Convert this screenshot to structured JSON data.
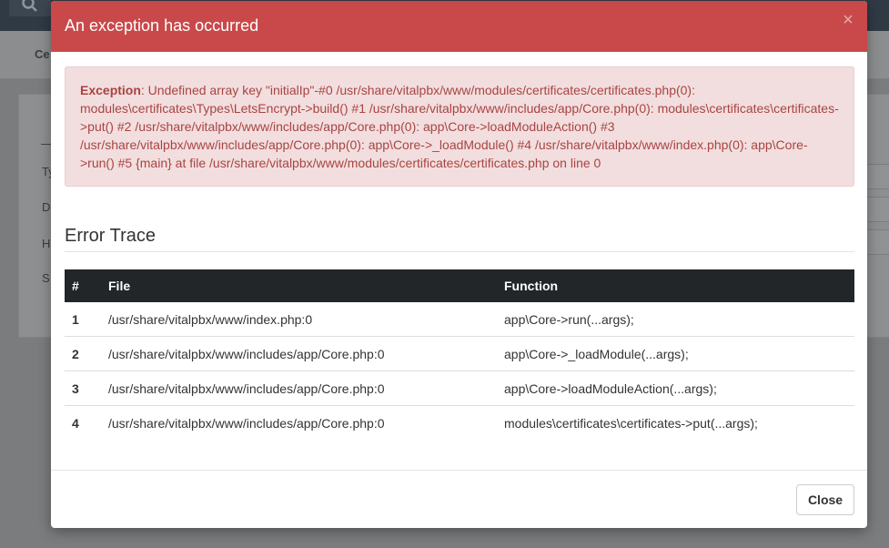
{
  "background": {
    "subbar_label": "Ce",
    "card_fields": [
      "Ty",
      "D",
      "H",
      "S"
    ]
  },
  "modal": {
    "title": "An exception has occurred",
    "close_icon": "×",
    "alert": {
      "label": "Exception",
      "message": ": Undefined array key \"initialIp\"-#0 /usr/share/vitalpbx/www/modules/certificates/certificates.php(0): modules\\certificates\\Types\\LetsEncrypt->build() #1 /usr/share/vitalpbx/www/includes/app/Core.php(0): modules\\certificates\\certificates->put() #2 /usr/share/vitalpbx/www/includes/app/Core.php(0): app\\Core->loadModuleAction() #3 /usr/share/vitalpbx/www/includes/app/Core.php(0): app\\Core->_loadModule() #4 /usr/share/vitalpbx/www/index.php(0): app\\Core->run() #5 {main} at file /usr/share/vitalpbx/www/modules/certificates/certificates.php on line 0"
    },
    "trace_title": "Error Trace",
    "table": {
      "headers": [
        "#",
        "File",
        "Function"
      ],
      "rows": [
        {
          "num": "1",
          "file": "/usr/share/vitalpbx/www/index.php:0",
          "function": "app\\Core->run(...args);"
        },
        {
          "num": "2",
          "file": "/usr/share/vitalpbx/www/includes/app/Core.php:0",
          "function": "app\\Core->_loadModule(...args);"
        },
        {
          "num": "3",
          "file": "/usr/share/vitalpbx/www/includes/app/Core.php:0",
          "function": "app\\Core->loadModuleAction(...args);"
        },
        {
          "num": "4",
          "file": "/usr/share/vitalpbx/www/includes/app/Core.php:0",
          "function": "modules\\certificates\\certificates->put(...args);"
        }
      ]
    },
    "footer": {
      "close_label": "Close"
    }
  },
  "colors": {
    "header_bg": "#c9494a",
    "alert_bg": "#f2dede",
    "alert_text": "#a94442",
    "table_header_bg": "#222629"
  }
}
